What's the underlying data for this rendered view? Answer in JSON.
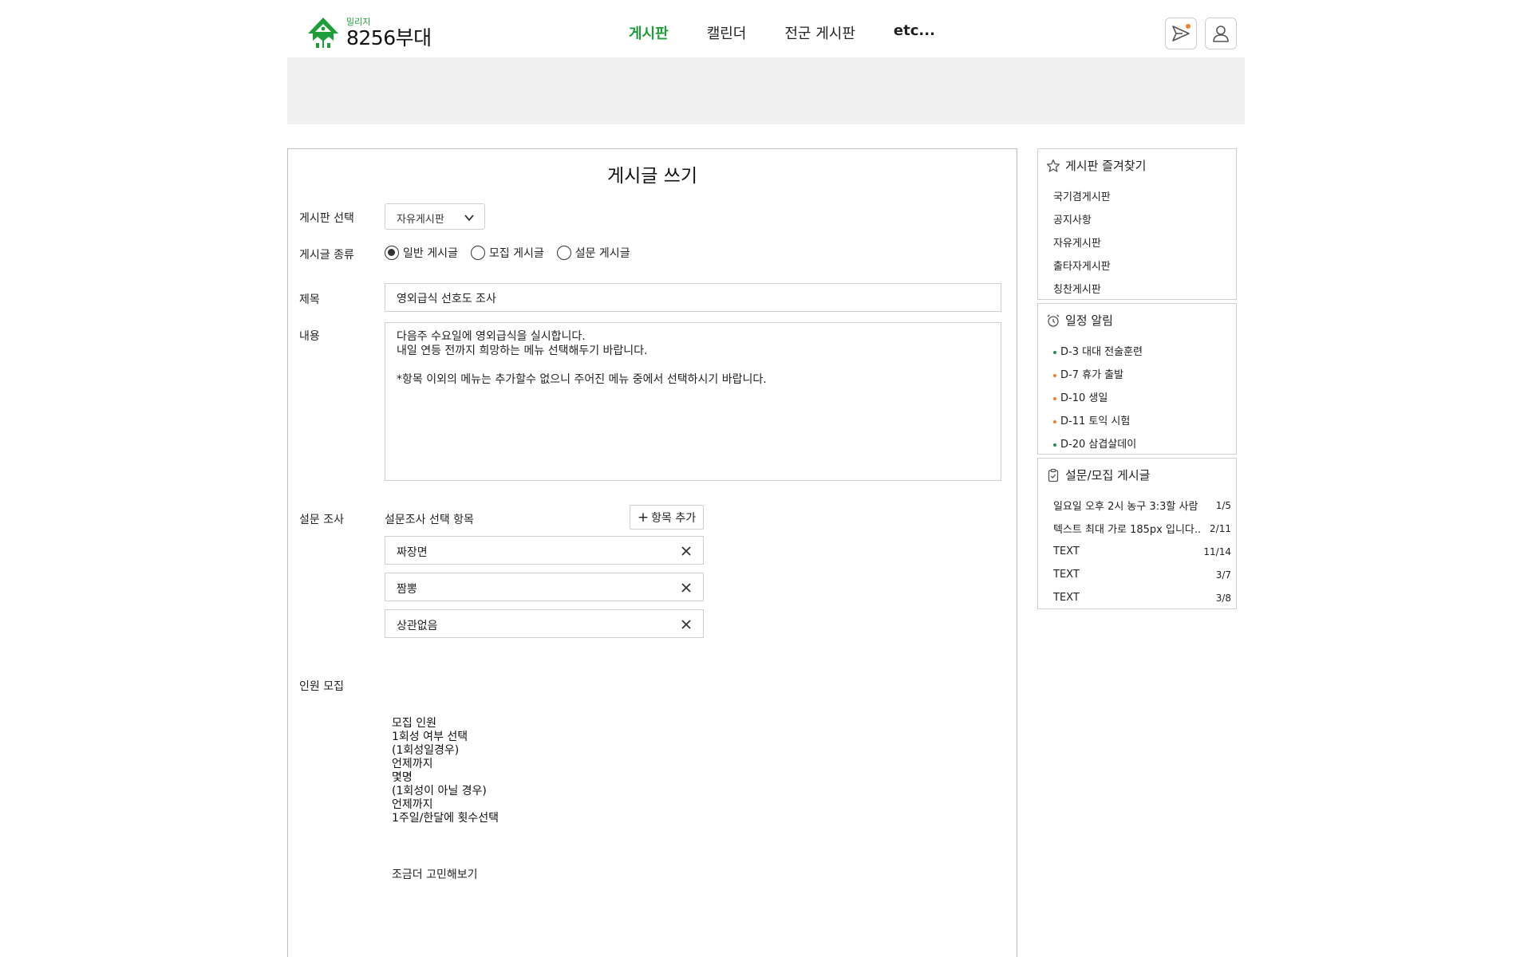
{
  "header": {
    "logo_small": "밀리지",
    "logo_big": "8256부대",
    "nav": [
      "게시판",
      "캘린더",
      "전군 게시판",
      "etc..."
    ],
    "brand_color": "#1e9e3a"
  },
  "form": {
    "title": "게시글 쓰기",
    "board_label": "게시판 선택",
    "board_value": "자유게시판",
    "type_label": "게시글 종류",
    "types": [
      "일반 게시글",
      "모집 게시글",
      "설문 게시글"
    ],
    "selected_type": "일반 게시글",
    "subject_label": "제목",
    "subject_value": "영외급식 선호도 조사",
    "content_label": "내용",
    "content_lines": [
      "다음주 수요일에 영외급식을 실시합니다.",
      "내일 연등 전까지 희망하는 메뉴 선택해두기 바랍니다.",
      "",
      "*항목 이외의 메뉴는 추가할수 없으니 주어진 메뉴 중에서 선택하시기 바랍니다."
    ],
    "survey_label": "설문 조사",
    "survey_heading": "설문조사 선택 항목",
    "add_option": "항목 추가",
    "options": [
      "짜장면",
      "짬뽕",
      "상관없음"
    ],
    "recruit_label": "인원 모집",
    "recruit_notes": [
      "모집 인원",
      "1회성 여부 선택",
      "(1회성일경우)",
      "언제까지",
      "몇명",
      "(1회성이 아닐 경우)",
      "언제까지",
      "1주일/한달에 횟수선택"
    ],
    "recruit_extra": "조금더 고민해보기"
  },
  "sidebar": {
    "favorites_title": "게시판 즐겨찾기",
    "favorites": [
      "국기겸게시판",
      "공지사항",
      "자유게시판",
      "출타자게시판",
      "칭찬게시판"
    ],
    "schedule_title": "일정 알림",
    "schedule": [
      {
        "text": "D-3 대대 전술훈련",
        "color": "#2e8b57"
      },
      {
        "text": "D-7 휴가 출발",
        "color": "#f08030"
      },
      {
        "text": "D-10 생일",
        "color": "#f08030"
      },
      {
        "text": "D-11 토익 시험",
        "color": "#f08030"
      },
      {
        "text": "D-20 삼겹살데이",
        "color": "#2e8b57"
      }
    ],
    "survey_title": "설문/모집 게시글",
    "surveys": [
      {
        "text": "일요일 오후 2시 농구 3:3할 사람",
        "count": "1/5"
      },
      {
        "text": "텍스트 최대 가로 185px 입니다..",
        "count": "2/11"
      },
      {
        "text": "TEXT",
        "count": "11/14"
      },
      {
        "text": "TEXT",
        "count": "3/7"
      },
      {
        "text": "TEXT",
        "count": "3/8"
      }
    ]
  }
}
